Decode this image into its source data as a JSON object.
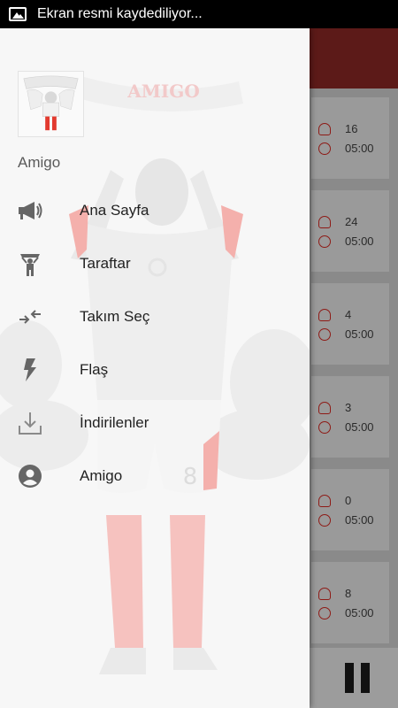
{
  "status_bar": {
    "notification_text": "Ekran resmi kaydediliyor...",
    "notification_icon": "image-icon"
  },
  "drawer": {
    "username": "Amigo",
    "banner_text": "AMIGO",
    "jersey_number": "8",
    "menu": [
      {
        "label": "Ana Sayfa",
        "icon": "megaphone-icon"
      },
      {
        "label": "Taraftar",
        "icon": "fan-icon"
      },
      {
        "label": "Takım Seç",
        "icon": "swap-arrows-icon"
      },
      {
        "label": "Flaş",
        "icon": "flash-icon"
      },
      {
        "label": "İndirilenler",
        "icon": "download-icon"
      },
      {
        "label": "Amigo",
        "icon": "account-circle-icon"
      }
    ]
  },
  "background_list": [
    {
      "count": "16",
      "duration": "05:00"
    },
    {
      "count": "24",
      "duration": "05:00"
    },
    {
      "count": "4",
      "duration": "05:00"
    },
    {
      "count": "3",
      "duration": "05:00"
    },
    {
      "count": "0",
      "duration": "05:00"
    },
    {
      "count": "8",
      "duration": "05:00"
    }
  ],
  "colors": {
    "accent": "#8e1b16",
    "toolbar": "#5c1a18",
    "drawer_bg": "#f7f7f7"
  }
}
